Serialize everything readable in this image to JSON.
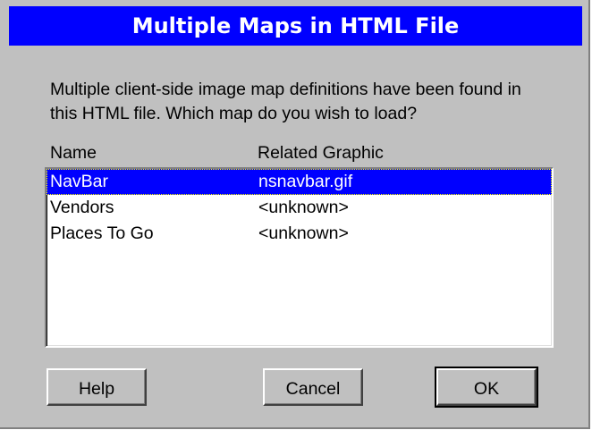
{
  "dialog": {
    "title": "Multiple Maps in HTML File",
    "message_line1": "Multiple client-side image map definitions have been found in",
    "message_line2": "this HTML file. Which map do you wish to load?"
  },
  "list": {
    "headers": {
      "name": "Name",
      "graphic": "Related Graphic"
    },
    "rows": [
      {
        "name": "NavBar",
        "graphic": "nsnavbar.gif",
        "selected": true
      },
      {
        "name": "Vendors",
        "graphic": "<unknown>",
        "selected": false
      },
      {
        "name": "Places To Go",
        "graphic": "<unknown>",
        "selected": false
      }
    ]
  },
  "buttons": {
    "help": "Help",
    "cancel": "Cancel",
    "ok": "OK"
  },
  "colors": {
    "titlebar": "#0000ff",
    "face": "#c0c0c0",
    "selection": "#0000ff"
  }
}
